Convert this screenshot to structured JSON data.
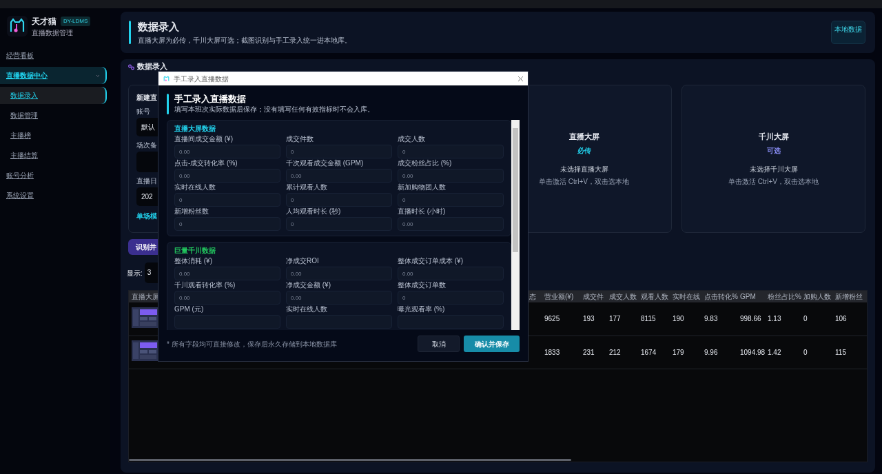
{
  "sidebar": {
    "app_name": "天才猫",
    "app_badge": "DY-LDMS",
    "app_subtitle": "直播数据管理",
    "nav": [
      {
        "label": "经营看板",
        "selected": false
      },
      {
        "label": "直播数据中心",
        "selected": true,
        "expanded": true,
        "children": [
          {
            "label": "数据录入",
            "selected": true
          },
          {
            "label": "数据管理",
            "selected": false
          },
          {
            "label": "主播榜",
            "selected": false
          },
          {
            "label": "主播结算",
            "selected": false
          }
        ]
      },
      {
        "label": "账号分析",
        "selected": false
      },
      {
        "label": "系统设置",
        "selected": false
      }
    ]
  },
  "header": {
    "title": "数据录入",
    "subtitle": "直播大屏为必传，千川大屏可选；截图识别与手工录入统一进本地库。",
    "badge": "本地数据"
  },
  "entry_panel": {
    "title": "数据录入",
    "form": {
      "title": "新建直",
      "fields": [
        {
          "label": "账号",
          "value": "默认"
        },
        {
          "label": "场次备"
        },
        {
          "label": "直播日",
          "value": "202"
        }
      ],
      "mode_label": "单场模"
    },
    "submit_button": "识别并",
    "display_label": "显示:",
    "display_value": "3",
    "upload_cards": [
      {
        "title": "直播大屏",
        "tag": "必传",
        "kind": "required",
        "status": "未选择直播大屏",
        "hint": "单击激活 Ctrl+V，双击选本地"
      },
      {
        "title": "千川大屏",
        "tag": "可选",
        "kind": "optional",
        "status": "未选择千川大屏",
        "hint": "单击激活 Ctrl+V，双击选本地"
      }
    ]
  },
  "table": {
    "thumbnail_column": "直播大屏",
    "columns": [
      "态",
      "营业额(¥)",
      "成交件",
      "成交人数",
      "观看人数",
      "实时在线",
      "点击转化%",
      "GPM",
      "粉丝占比%",
      "加购人数",
      "新增粉丝"
    ],
    "rows": [
      {
        "thumbnail": {
          "kind": "picture"
        },
        "cells": [
          "",
          "9625",
          "193",
          "177",
          "8115",
          "190",
          "9.83",
          "998.66",
          "1.13",
          "0",
          "106"
        ]
      },
      {
        "thumbnail": {
          "kind": "picture"
        },
        "cells": [
          "",
          "1833",
          "231",
          "212",
          "1674",
          "179",
          "9.96",
          "1094.98",
          "1.42",
          "0",
          "115"
        ]
      }
    ]
  },
  "modal": {
    "window_title": "手工录入直播数据",
    "title": "手工录入直播数据",
    "subtitle": "填写本班次实际数据后保存；没有填写任何有效指标时不会入库。",
    "sections": [
      {
        "title": "直播大屏数据",
        "kind": "live",
        "fields": [
          {
            "label": "直播间成交金额 (¥)",
            "placeholder": "0.00"
          },
          {
            "label": "成交件数",
            "placeholder": "0"
          },
          {
            "label": "成交人数",
            "placeholder": "0"
          },
          {
            "label": "点击-成交转化率 (%)",
            "placeholder": "0.00"
          },
          {
            "label": "千次观看成交金额 (GPM)",
            "placeholder": "0.00"
          },
          {
            "label": "成交粉丝占比 (%)",
            "placeholder": "0.00"
          },
          {
            "label": "实时在线人数",
            "placeholder": "0"
          },
          {
            "label": "累计观看人数",
            "placeholder": "0"
          },
          {
            "label": "新加购物团人数",
            "placeholder": "0"
          },
          {
            "label": "新增粉丝数",
            "placeholder": "0"
          },
          {
            "label": "人均观看时长 (秒)",
            "placeholder": "0"
          },
          {
            "label": "直播时长 (小时)",
            "placeholder": "0.00"
          }
        ]
      },
      {
        "title": "巨量千川数据",
        "kind": "ads",
        "fields": [
          {
            "label": "整体消耗 (¥)",
            "placeholder": "0.00"
          },
          {
            "label": "净成交ROI",
            "placeholder": "0.00"
          },
          {
            "label": "整体成交订单成本 (¥)",
            "placeholder": "0.00"
          },
          {
            "label": "千川观看转化率 (%)",
            "placeholder": "0.00"
          },
          {
            "label": "净成交金额 (¥)",
            "placeholder": "0.00"
          },
          {
            "label": "整体成交订单数",
            "placeholder": "0"
          },
          {
            "label": "GPM (元)"
          },
          {
            "label": "实时在线人数"
          },
          {
            "label": "曝光观看率 (%)"
          }
        ]
      }
    ],
    "footnote": "* 所有字段均可直接修改，保存后永久存储到本地数据库",
    "buttons": [
      {
        "label": "取消",
        "kind": "secondary"
      },
      {
        "label": "确认并保存",
        "kind": "primary"
      }
    ]
  }
}
